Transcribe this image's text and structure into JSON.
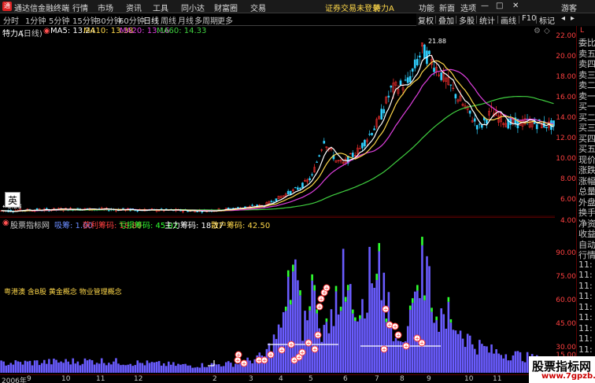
{
  "titlebar": {
    "app_title": "通达信金融终端",
    "menu": [
      "行情",
      "市场",
      "资讯",
      "工具",
      "同小达",
      "财富圈",
      "交易"
    ],
    "notice": "证券交易未登录",
    "stock": "特力A",
    "right_menu": [
      "功能",
      "新面",
      "选项"
    ],
    "guest": "游客"
  },
  "tabs": [
    "分时",
    "1分钟",
    "5分钟",
    "15分钟",
    "30分钟",
    "60分钟",
    "日线",
    "周线",
    "月线",
    "多周期",
    "更多"
  ],
  "active_tab": "日线",
  "ctrl": [
    "复权",
    "叠加",
    "多股",
    "统计",
    "画线",
    "F10",
    "标记"
  ],
  "ma_line": {
    "name": "特力A",
    "period": "(日线)",
    "ma5": "MA5: 13.24",
    "ma10": "MA10: 13.38",
    "ma20": "MA20: 13.16",
    "ma60": "MA60: 14.33"
  },
  "price_axis": [
    "22.00",
    "20.00",
    "18.00",
    "16.00",
    "14.00",
    "12.00",
    "10.00",
    "8.00",
    "6.00",
    "4.00"
  ],
  "price_marks": {
    "high": "21.88",
    "low": "3.28"
  },
  "ying_label": "英",
  "volume_header": {
    "name": "股票指标网",
    "v1": "吸筹: 1.00",
    "v2": "获利筹码: 18.89",
    "v3": "亏损筹码: 45.02",
    "v4": "主力筹码: 18.17",
    "v5": "散户筹码: 42.50"
  },
  "concepts": "粤港澳 含B股 黄金概念 物业管理概念",
  "volume_axis": [
    "90.00",
    "75.00",
    "60.00",
    "45.00",
    "30.00",
    "15.00"
  ],
  "x_axis": [
    "2006年",
    "9",
    "10",
    "11",
    "12",
    "2",
    "3",
    "4",
    "5",
    "6",
    "7",
    "8",
    "9",
    "10",
    "11"
  ],
  "sidebar": [
    "委比",
    "卖五",
    "卖四",
    "卖三",
    "卖二",
    "卖一",
    "买一",
    "买二",
    "买三",
    "买四",
    "买五",
    "现价",
    "涨跌",
    "涨幅",
    "总量",
    "外盘",
    "换手",
    "净资",
    "收益",
    "自动",
    "行情",
    "11:",
    "11:",
    "11:",
    "11:",
    "11:",
    "11:",
    "11:",
    "11:",
    "11:",
    "11:"
  ],
  "sidebar_badge": "L",
  "watermark": {
    "line1": "股票指标网",
    "line2": "www.7gpzb.com"
  },
  "colors": {
    "up": "#ff3030",
    "down": "#30d0ff",
    "ma5": "#ffffff",
    "ma10": "#ffd84a",
    "ma20": "#e040e0",
    "ma60": "#40d040",
    "volume": "#6a5cff",
    "volume_green": "#30ff30"
  }
}
